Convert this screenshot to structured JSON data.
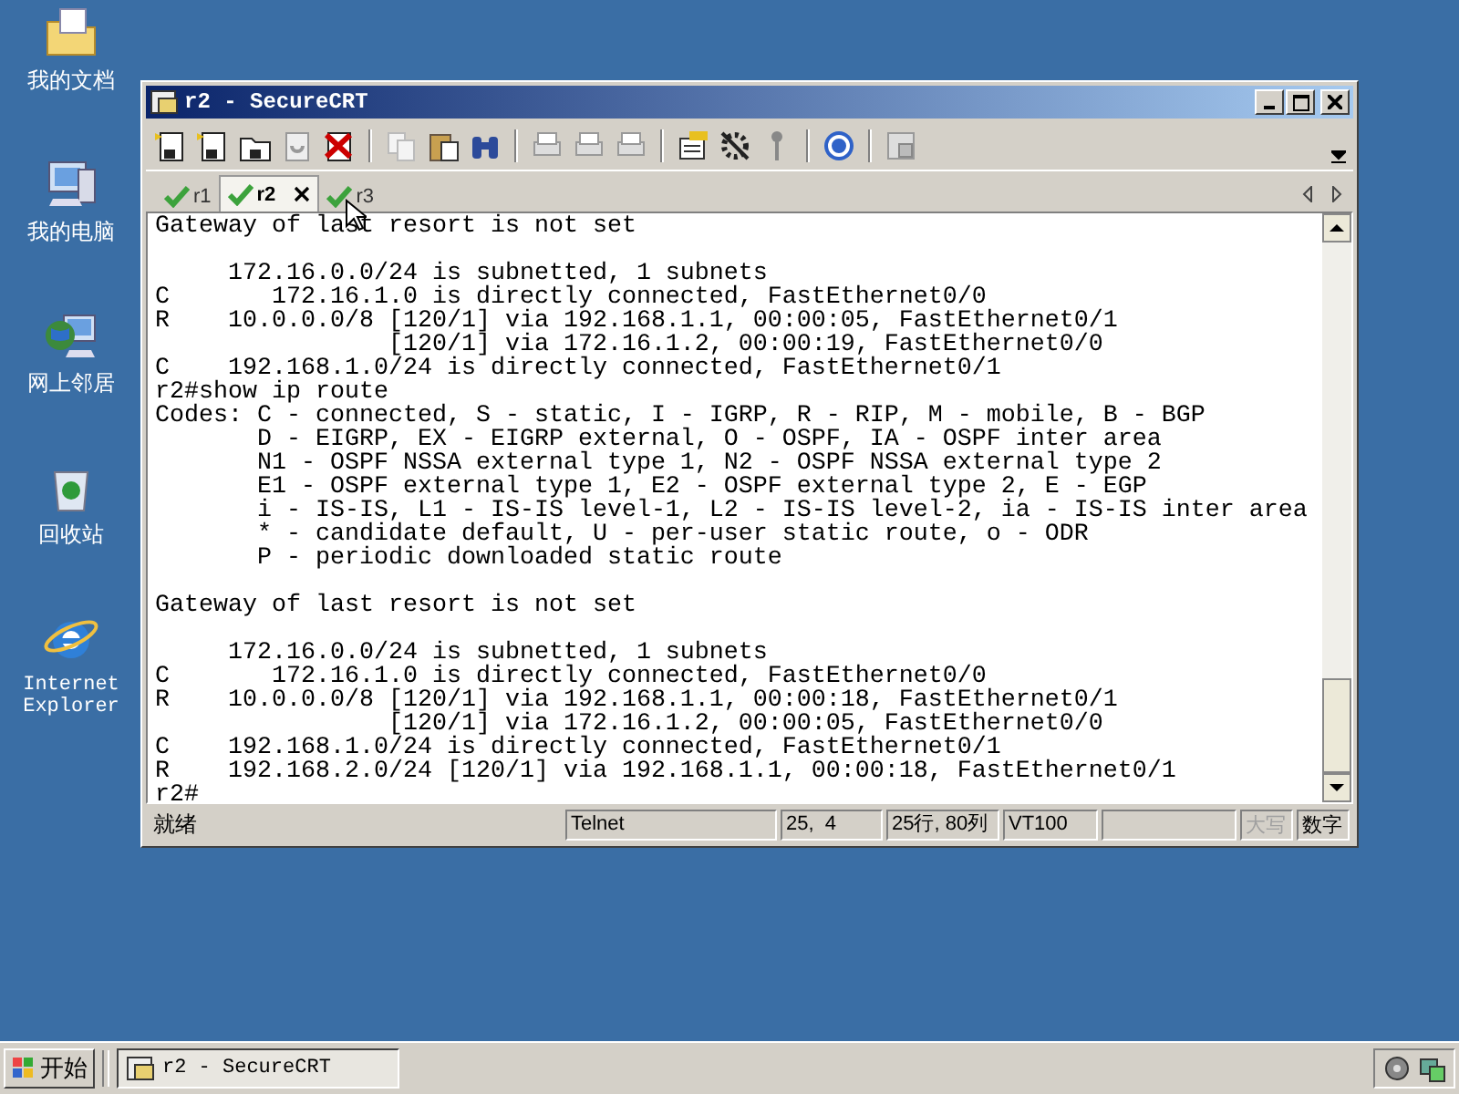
{
  "desktop_icons": [
    {
      "kind": "documents",
      "label": "我的文档"
    },
    {
      "kind": "computer",
      "label": "我的电脑"
    },
    {
      "kind": "network",
      "label": "网上邻居"
    },
    {
      "kind": "recycle",
      "label": "回收站"
    },
    {
      "kind": "browser",
      "label": "Internet Explorer"
    }
  ],
  "window": {
    "title": "r2 - SecureCRT"
  },
  "tabs": [
    {
      "label": "r1",
      "selected": false
    },
    {
      "label": "r2",
      "selected": true
    },
    {
      "label": "r3",
      "selected": false
    }
  ],
  "terminal": {
    "lines": [
      {
        "text": "Gateway of last resort is not set",
        "blank_before": false
      },
      {
        "text": "     172.16.0.0/24 is subnetted, 1 subnets",
        "blank_before": true
      },
      {
        "text": "C       172.16.1.0 is directly connected, FastEthernet0/0",
        "blank_before": false
      },
      {
        "text": "R    10.0.0.0/8 [120/1] via 192.168.1.1, 00:00:05, FastEthernet0/1",
        "blank_before": false
      },
      {
        "text": "                [120/1] via 172.16.1.2, 00:00:19, FastEthernet0/0",
        "blank_before": false
      },
      {
        "text": "C    192.168.1.0/24 is directly connected, FastEthernet0/1",
        "blank_before": false
      },
      {
        "text": "r2#show ip route",
        "blank_before": false
      },
      {
        "text": "Codes: C - connected, S - static, I - IGRP, R - RIP, M - mobile, B - BGP",
        "blank_before": false
      },
      {
        "text": "       D - EIGRP, EX - EIGRP external, O - OSPF, IA - OSPF inter area",
        "blank_before": false
      },
      {
        "text": "       N1 - OSPF NSSA external type 1, N2 - OSPF NSSA external type 2",
        "blank_before": false
      },
      {
        "text": "       E1 - OSPF external type 1, E2 - OSPF external type 2, E - EGP",
        "blank_before": false
      },
      {
        "text": "       i - IS-IS, L1 - IS-IS level-1, L2 - IS-IS level-2, ia - IS-IS inter area",
        "blank_before": false
      },
      {
        "text": "       * - candidate default, U - per-user static route, o - ODR",
        "blank_before": false
      },
      {
        "text": "       P - periodic downloaded static route",
        "blank_before": false
      },
      {
        "text": "Gateway of last resort is not set",
        "blank_before": true
      },
      {
        "text": "     172.16.0.0/24 is subnetted, 1 subnets",
        "blank_before": true
      },
      {
        "text": "C       172.16.1.0 is directly connected, FastEthernet0/0",
        "blank_before": false
      },
      {
        "text": "R    10.0.0.0/8 [120/1] via 192.168.1.1, 00:00:18, FastEthernet0/1",
        "blank_before": false
      },
      {
        "text": "                [120/1] via 172.16.1.2, 00:00:05, FastEthernet0/0",
        "blank_before": false
      },
      {
        "text": "C    192.168.1.0/24 is directly connected, FastEthernet0/1",
        "blank_before": false
      },
      {
        "text": "R    192.168.2.0/24 [120/1] via 192.168.1.1, 00:00:18, FastEthernet0/1",
        "blank_before": false
      },
      {
        "text": "r2#",
        "blank_before": false
      }
    ]
  },
  "status_bar": {
    "status": "就绪",
    "cells": [
      {
        "text": "Telnet",
        "disabled": false
      },
      {
        "text": "25,  4",
        "disabled": false
      },
      {
        "text": "25行, 80列",
        "disabled": false
      },
      {
        "text": "VT100",
        "disabled": false
      },
      {
        "text": "大写",
        "disabled": true
      },
      {
        "text": "数字",
        "disabled": false
      }
    ]
  },
  "taskbar": {
    "start": "开始",
    "tasks": [
      {
        "label": "r2 - SecureCRT",
        "selected": true
      }
    ]
  }
}
